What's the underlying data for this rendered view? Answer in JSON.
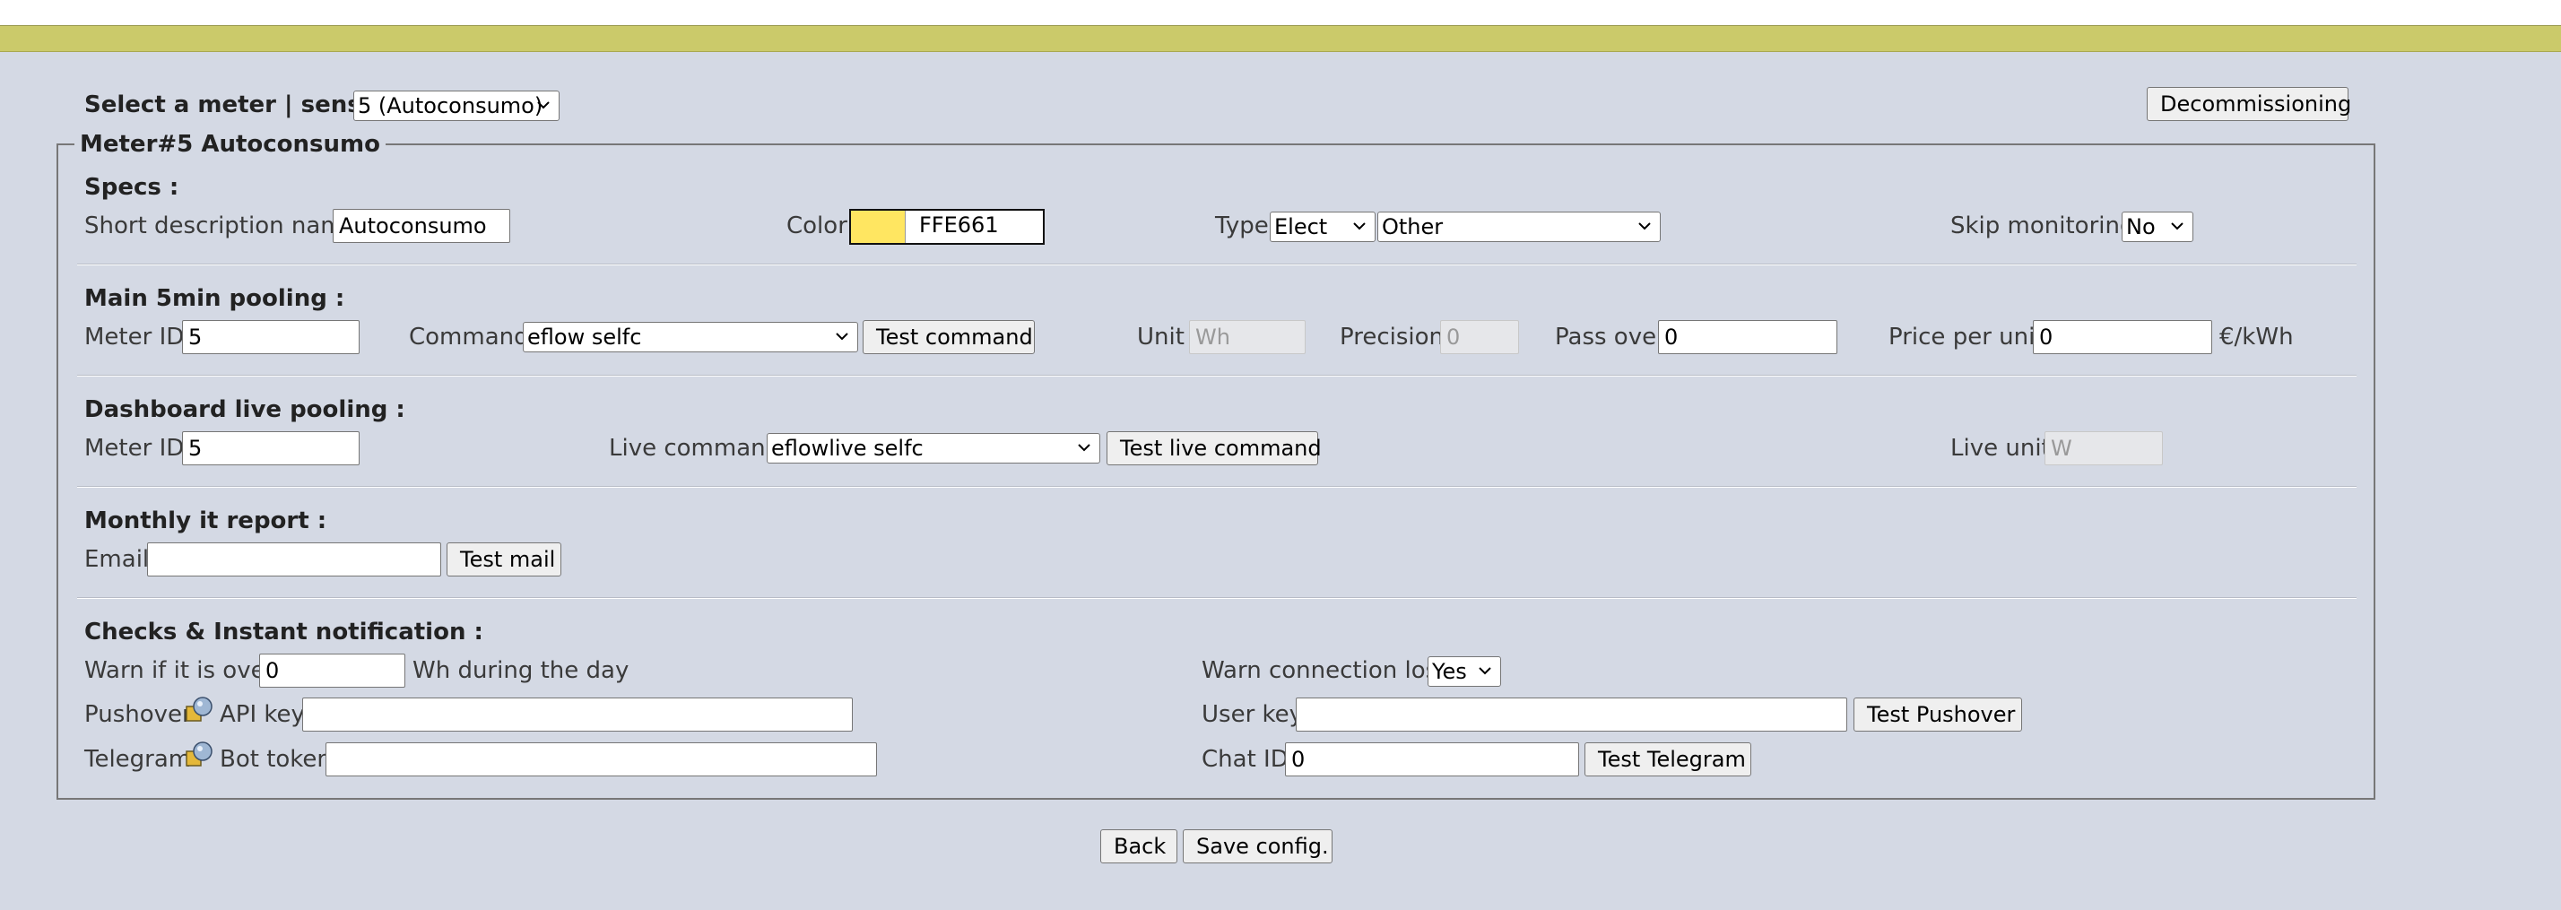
{
  "header": {
    "select_label": "Select a meter | sensor :",
    "meter_select": "5 (Autoconsumo)",
    "decommission_button": "Decommissioning"
  },
  "meter": {
    "legend": "Meter#5 Autoconsumo",
    "specs": {
      "heading": "Specs :",
      "short_desc_label": "Short description name",
      "short_desc_value": "Autoconsumo",
      "color_label": "Color",
      "color_hex": "FFE661",
      "color_swatch": "#FFE661",
      "type_label": "Type",
      "type_value": "Elect",
      "subtype_value": "Other",
      "skip_label": "Skip monitoring",
      "skip_value": "No"
    },
    "main_pooling": {
      "heading": "Main 5min pooling :",
      "meter_id_label": "Meter ID",
      "meter_id_value": "5",
      "command_label": "Command",
      "command_value": "eflow selfc",
      "test_command_button": "Test command",
      "unit_label": "Unit",
      "unit_value": "Wh",
      "precision_label": "Precision",
      "precision_value": "0",
      "pass_over_label": "Pass over",
      "pass_over_value": "0",
      "price_label": "Price per unit",
      "price_value": "0",
      "price_unit": "€/kWh"
    },
    "live_pooling": {
      "heading": "Dashboard live pooling :",
      "meter_id_label": "Meter ID",
      "meter_id_value": "5",
      "live_command_label": "Live command",
      "live_command_value": "eflowlive selfc",
      "test_live_button": "Test live command",
      "live_unit_label": "Live unit",
      "live_unit_value": "W"
    },
    "monthly_report": {
      "heading": "Monthly it report :",
      "email_label": "Email",
      "email_value": "",
      "test_mail_button": "Test mail"
    },
    "checks": {
      "heading": "Checks & Instant notification :",
      "warn_label": "Warn if it is over",
      "warn_value": "0",
      "warn_suffix": "Wh during the day",
      "warn_conn_label": "Warn connection lost",
      "warn_conn_value": "Yes",
      "pushover_label": "Pushover",
      "api_key_label": "API key",
      "api_key_value": "",
      "user_key_label": "User key",
      "user_key_value": "",
      "test_pushover_button": "Test Pushover",
      "telegram_label": "Telegram",
      "bot_token_label": "Bot token",
      "bot_token_value": "",
      "chat_id_label": "Chat ID",
      "chat_id_value": "0",
      "test_telegram_button": "Test Telegram"
    }
  },
  "footer": {
    "back_button": "Back",
    "save_button": "Save config."
  }
}
